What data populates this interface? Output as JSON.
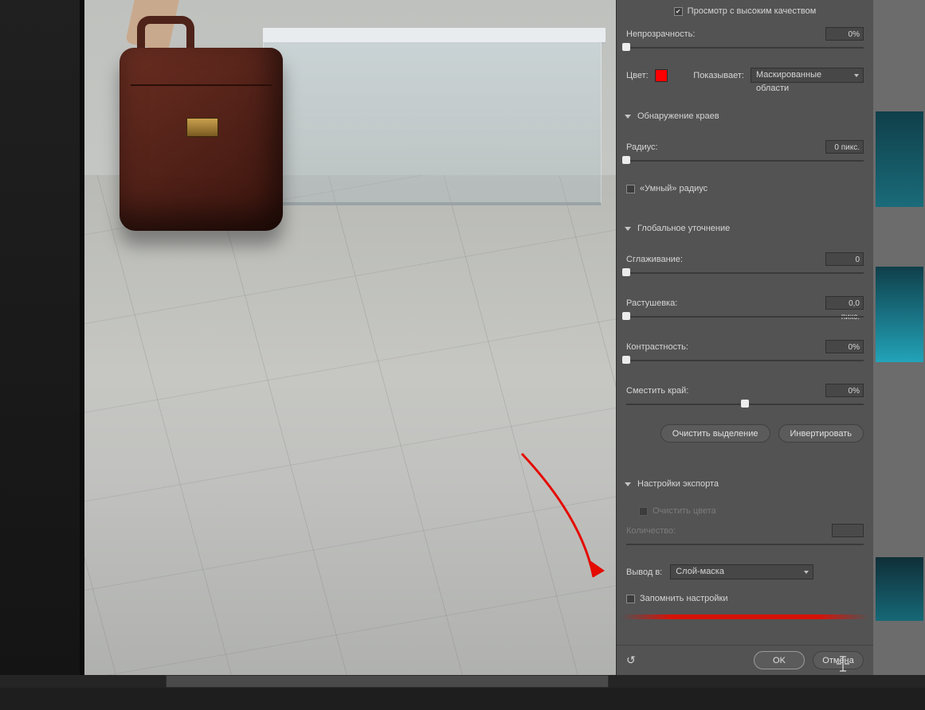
{
  "topbar": {
    "high_quality_preview": "Просмотр с высоким качеством"
  },
  "opacity": {
    "label": "Непрозрачность:",
    "value": "0%"
  },
  "color_row": {
    "label": "Цвет:",
    "swatch": "#ff0000",
    "shows_label": "Показывает:",
    "shows_value": "Маскированные области"
  },
  "edge": {
    "title": "Обнаружение краев",
    "radius_label": "Радиус:",
    "radius_value": "0 пикс.",
    "smart_radius": "«Умный» радиус"
  },
  "global": {
    "title": "Глобальное уточнение",
    "smooth_label": "Сглаживание:",
    "smooth_value": "0",
    "feather_label": "Растушевка:",
    "feather_value": "0,0 пикс.",
    "contrast_label": "Контрастность:",
    "contrast_value": "0%",
    "shift_label": "Сместить край:",
    "shift_value": "0%",
    "clear_btn": "Очистить выделение",
    "invert_btn": "Инвертировать"
  },
  "export": {
    "title": "Настройки экспорта",
    "clean_colors": "Очистить цвета",
    "amount_label": "Количество:",
    "amount_value": "",
    "output_label": "Вывод в:",
    "output_value": "Слой-маска"
  },
  "remember": "Запомнить настройки",
  "footer": {
    "reset_icon": "↺",
    "ok": "OK",
    "cancel": "Отмена"
  }
}
